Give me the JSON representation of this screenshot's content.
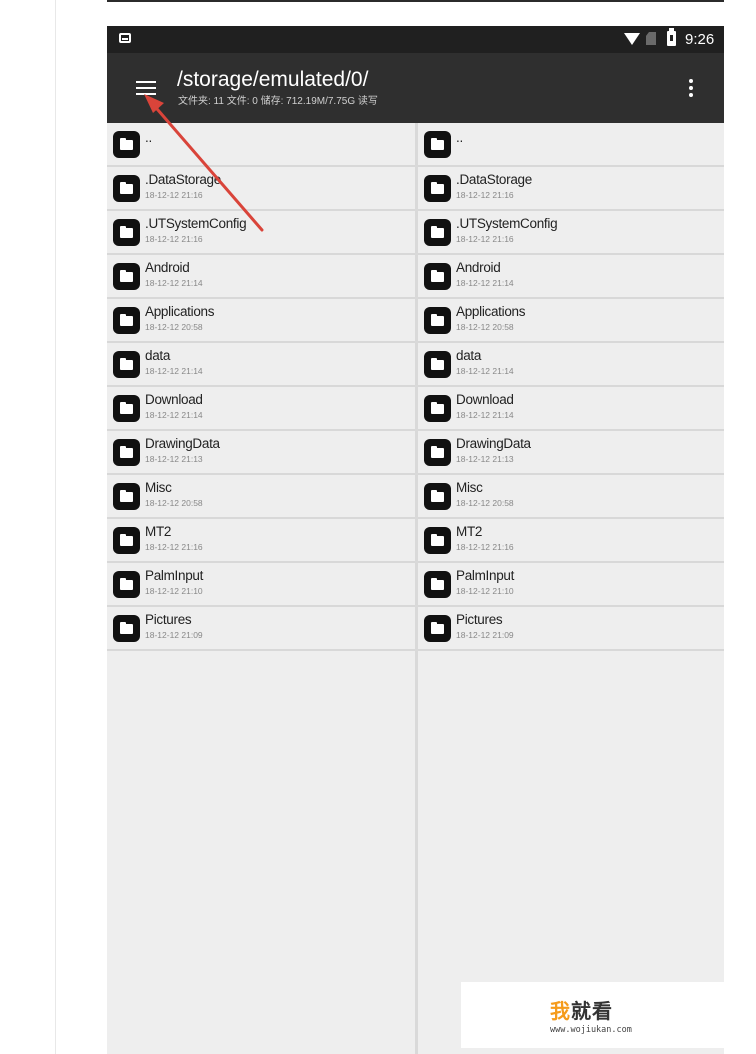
{
  "status_bar": {
    "time": "9:26",
    "icons": [
      "notification-icon",
      "wifi-icon",
      "no-sim-icon",
      "battery-icon"
    ]
  },
  "app_bar": {
    "path": "/storage/emulated/0/",
    "summary": "文件夹: 11  文件: 0  储存: 712.19M/7.75G  读写",
    "menu_icon": "hamburger-menu-icon",
    "overflow_icon": "more-vert-icon"
  },
  "left_pane": {
    "items": [
      {
        "name": "..",
        "date": ""
      },
      {
        "name": ".DataStorage",
        "date": "18-12-12 21:16"
      },
      {
        "name": ".UTSystemConfig",
        "date": "18-12-12 21:16"
      },
      {
        "name": "Android",
        "date": "18-12-12 21:14"
      },
      {
        "name": "Applications",
        "date": "18-12-12 20:58"
      },
      {
        "name": "data",
        "date": "18-12-12 21:14"
      },
      {
        "name": "Download",
        "date": "18-12-12 21:14"
      },
      {
        "name": "DrawingData",
        "date": "18-12-12 21:13"
      },
      {
        "name": "Misc",
        "date": "18-12-12 20:58"
      },
      {
        "name": "MT2",
        "date": "18-12-12 21:16"
      },
      {
        "name": "PalmInput",
        "date": "18-12-12 21:10"
      },
      {
        "name": "Pictures",
        "date": "18-12-12 21:09"
      }
    ]
  },
  "right_pane": {
    "items": [
      {
        "name": "..",
        "date": ""
      },
      {
        "name": ".DataStorage",
        "date": "18-12-12 21:16"
      },
      {
        "name": ".UTSystemConfig",
        "date": "18-12-12 21:16"
      },
      {
        "name": "Android",
        "date": "18-12-12 21:14"
      },
      {
        "name": "Applications",
        "date": "18-12-12 20:58"
      },
      {
        "name": "data",
        "date": "18-12-12 21:14"
      },
      {
        "name": "Download",
        "date": "18-12-12 21:14"
      },
      {
        "name": "DrawingData",
        "date": "18-12-12 21:13"
      },
      {
        "name": "Misc",
        "date": "18-12-12 20:58"
      },
      {
        "name": "MT2",
        "date": "18-12-12 21:16"
      },
      {
        "name": "PalmInput",
        "date": "18-12-12 21:10"
      },
      {
        "name": "Pictures",
        "date": "18-12-12 21:09"
      }
    ]
  },
  "watermark": {
    "accent": "我",
    "rest": "就看",
    "url": "www.wojiukan.com"
  },
  "colors": {
    "status_bar": "#202020",
    "app_bar": "#2f2f2f",
    "pane_bg": "#eeeeee",
    "annotation_arrow": "#d9443a",
    "watermark_accent": "#f59b1b"
  }
}
